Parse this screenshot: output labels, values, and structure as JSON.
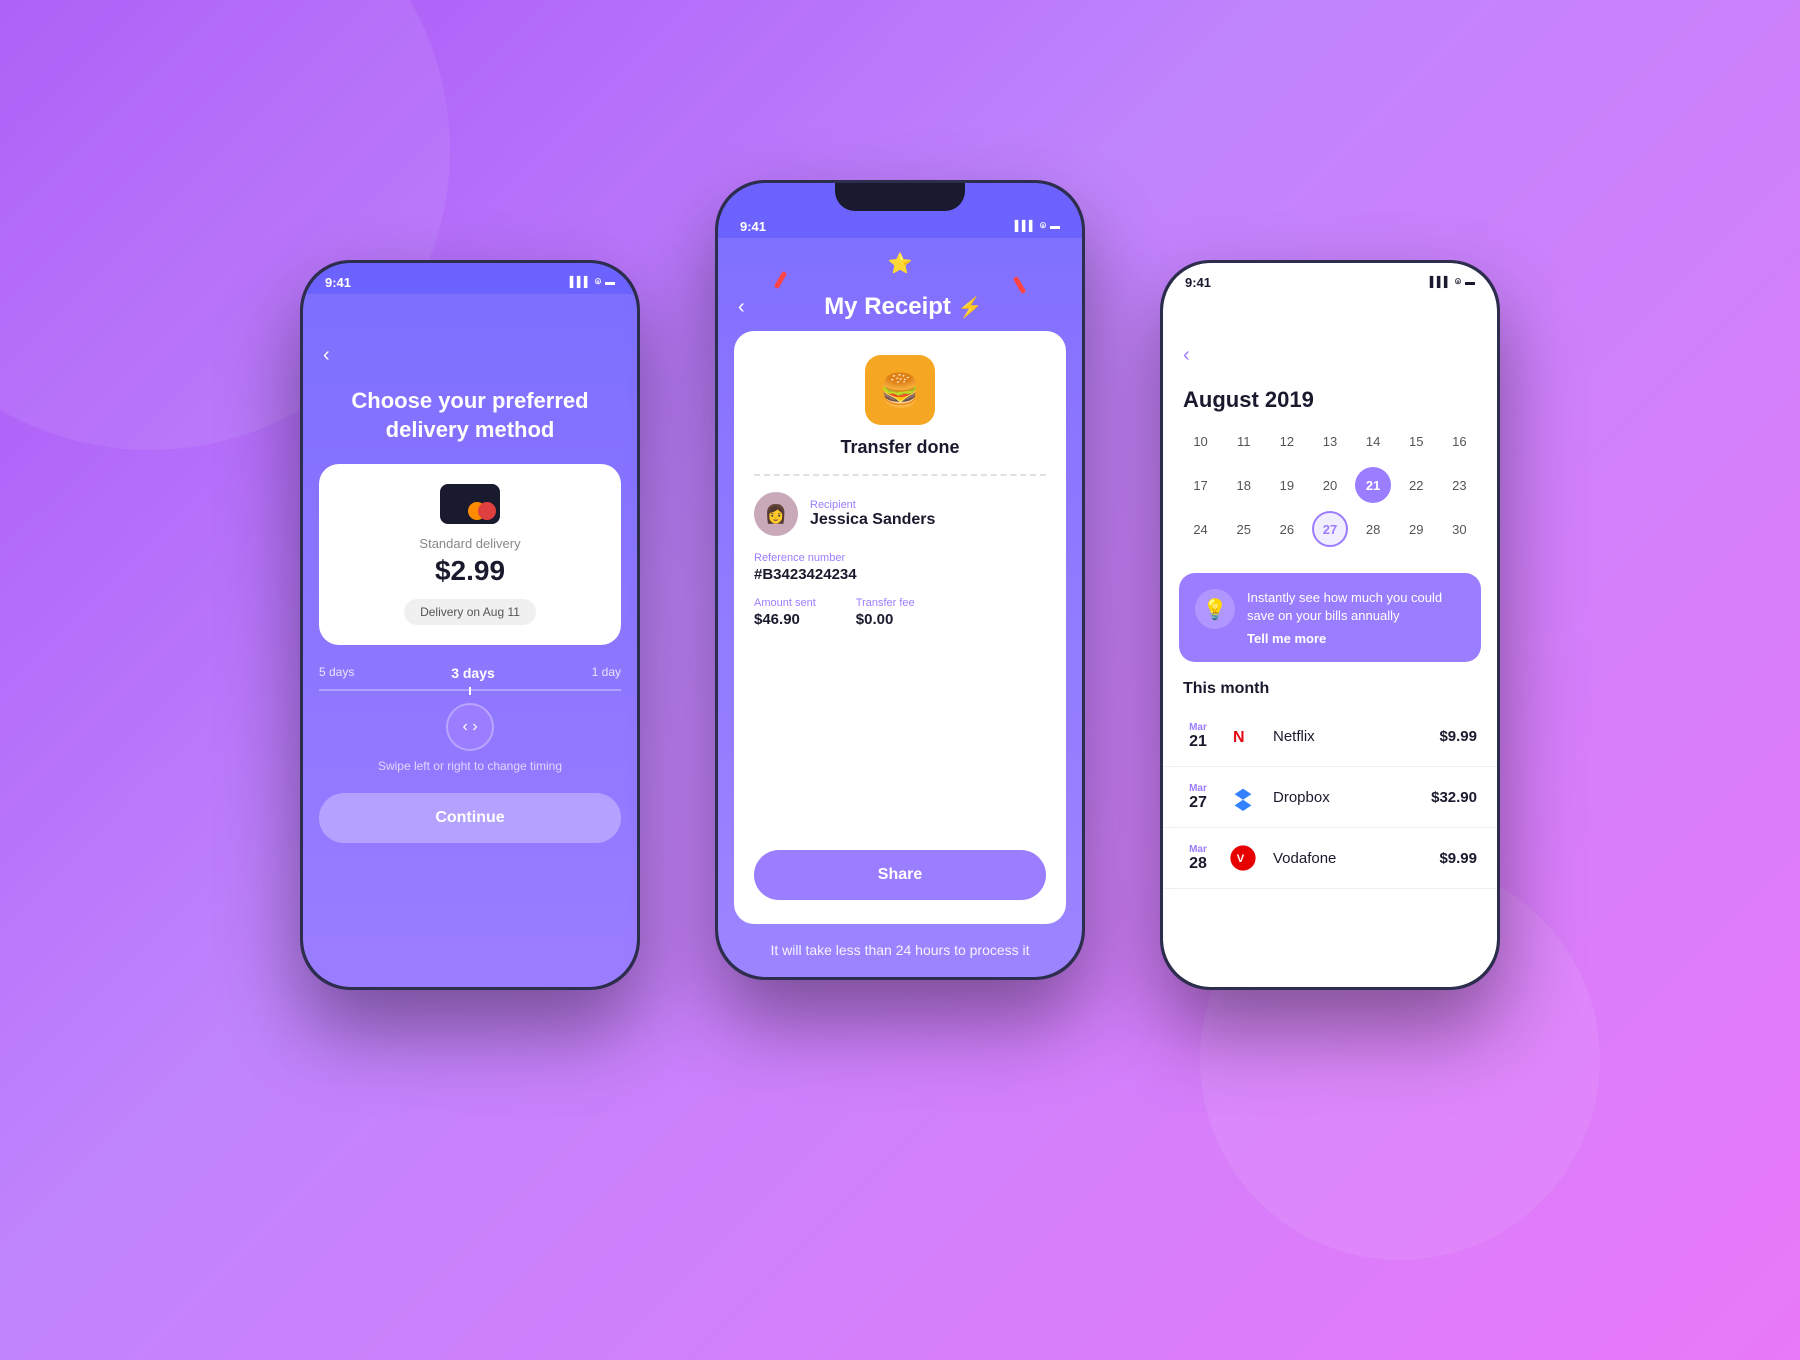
{
  "background": {
    "gradient_start": "#a855f7",
    "gradient_end": "#e879f9"
  },
  "left_phone": {
    "status_time": "9:41",
    "title": "Choose your preferred delivery method",
    "card": {
      "delivery_label": "Standard delivery",
      "price": "$2.99",
      "date_badge": "Delivery on Aug 11"
    },
    "timing": {
      "left_label": "5 days",
      "center_label": "3 days",
      "right_label": "1 day"
    },
    "swipe_hint": "Swipe left or right to change timing",
    "continue_button": "Continue"
  },
  "center_phone": {
    "status_time": "9:41",
    "title": "My Receipt",
    "transfer_status": "Transfer done",
    "recipient_label": "Recipient",
    "recipient_name": "Jessica Sanders",
    "reference_label": "Reference number",
    "reference_value": "#B3423424234",
    "amount_label": "Amount sent",
    "amount_value": "$46.90",
    "fee_label": "Transfer fee",
    "fee_value": "$0.00",
    "share_button": "Share",
    "processing_text": "It will take less than 24 hours to process it"
  },
  "right_phone": {
    "status_time": "9:41",
    "calendar_month": "August 2019",
    "calendar_rows": [
      [
        "10",
        "11",
        "12",
        "13",
        "14",
        "15",
        "16"
      ],
      [
        "17",
        "18",
        "19",
        "20",
        "21",
        "22",
        "23"
      ],
      [
        "24",
        "25",
        "26",
        "27",
        "28",
        "29",
        "30"
      ]
    ],
    "today": "21",
    "selected": "27",
    "savings_banner": {
      "text": "Instantly see how much you could save on your bills annually",
      "cta": "Tell me more"
    },
    "this_month_label": "This month",
    "bills": [
      {
        "month": "Mar",
        "day": "21",
        "name": "Netflix",
        "amount": "$9.99",
        "logo_type": "netflix"
      },
      {
        "month": "Mar",
        "day": "27",
        "name": "Dropbox",
        "amount": "$32.90",
        "logo_type": "dropbox"
      },
      {
        "month": "Mar",
        "day": "28",
        "name": "Vodafone",
        "amount": "$9.99",
        "logo_type": "vodafone"
      }
    ]
  }
}
